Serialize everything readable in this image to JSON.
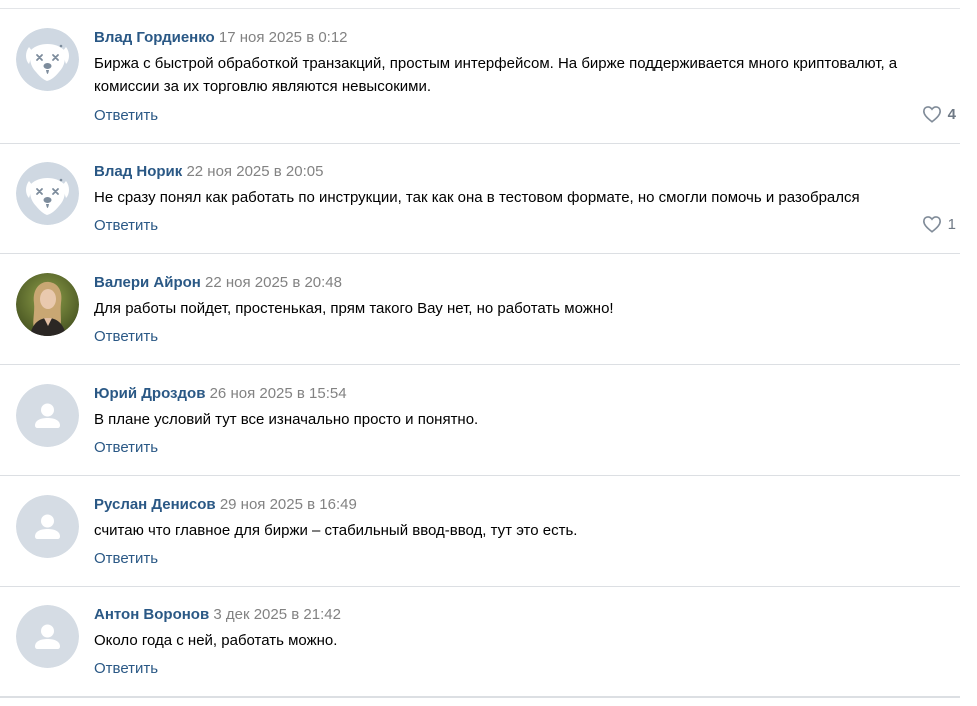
{
  "comments": [
    {
      "author": "Влад Гордиенко",
      "date": "17 ноя 2025 в 0:12",
      "text": "Биржа с быстрой обработкой транзакций, простым интерфейсом. На бирже поддерживается много криптовалют, а комиссии за их торговлю являются невысокими.",
      "reply_label": "Ответить",
      "likes": "4",
      "avatar": "dog-avatar-icon"
    },
    {
      "author": "Влад Норик",
      "date": "22 ноя 2025 в 20:05",
      "text": "Не сразу понял как работать по инструкции, так как она в тестовом формате, но смогли помочь и разобрался",
      "reply_label": "Ответить",
      "likes": "1",
      "avatar": "dog-avatar-icon"
    },
    {
      "author": "Валери Айрон",
      "date": "22 ноя 2025 в 20:48",
      "text": "Для работы пойдет, простенькая, прям такого Вау нет, но работать можно!",
      "reply_label": "Ответить",
      "avatar": "photo-avatar"
    },
    {
      "author": "Юрий Дроздов",
      "date": "26 ноя 2025 в 15:54",
      "text": "В плане условий тут все изначально просто и понятно.",
      "reply_label": "Ответить",
      "avatar": "default-user-icon"
    },
    {
      "author": "Руслан Денисов",
      "date": "29 ноя 2025 в 16:49",
      "text": "считаю что главное для биржи – стабильный ввод-ввод, тут это есть.",
      "reply_label": "Ответить",
      "avatar": "default-user-icon"
    },
    {
      "author": "Антон Воронов",
      "date": "3 дек 2025 в 21:42",
      "text": "Около года с ней, работать можно.",
      "reply_label": "Ответить",
      "avatar": "default-user-icon"
    }
  ],
  "colors": {
    "author": "#2a5885",
    "date": "#828282",
    "reply": "#2a5885",
    "avatar_bg": "#cfd8e2",
    "divider": "#dcdfe3"
  }
}
